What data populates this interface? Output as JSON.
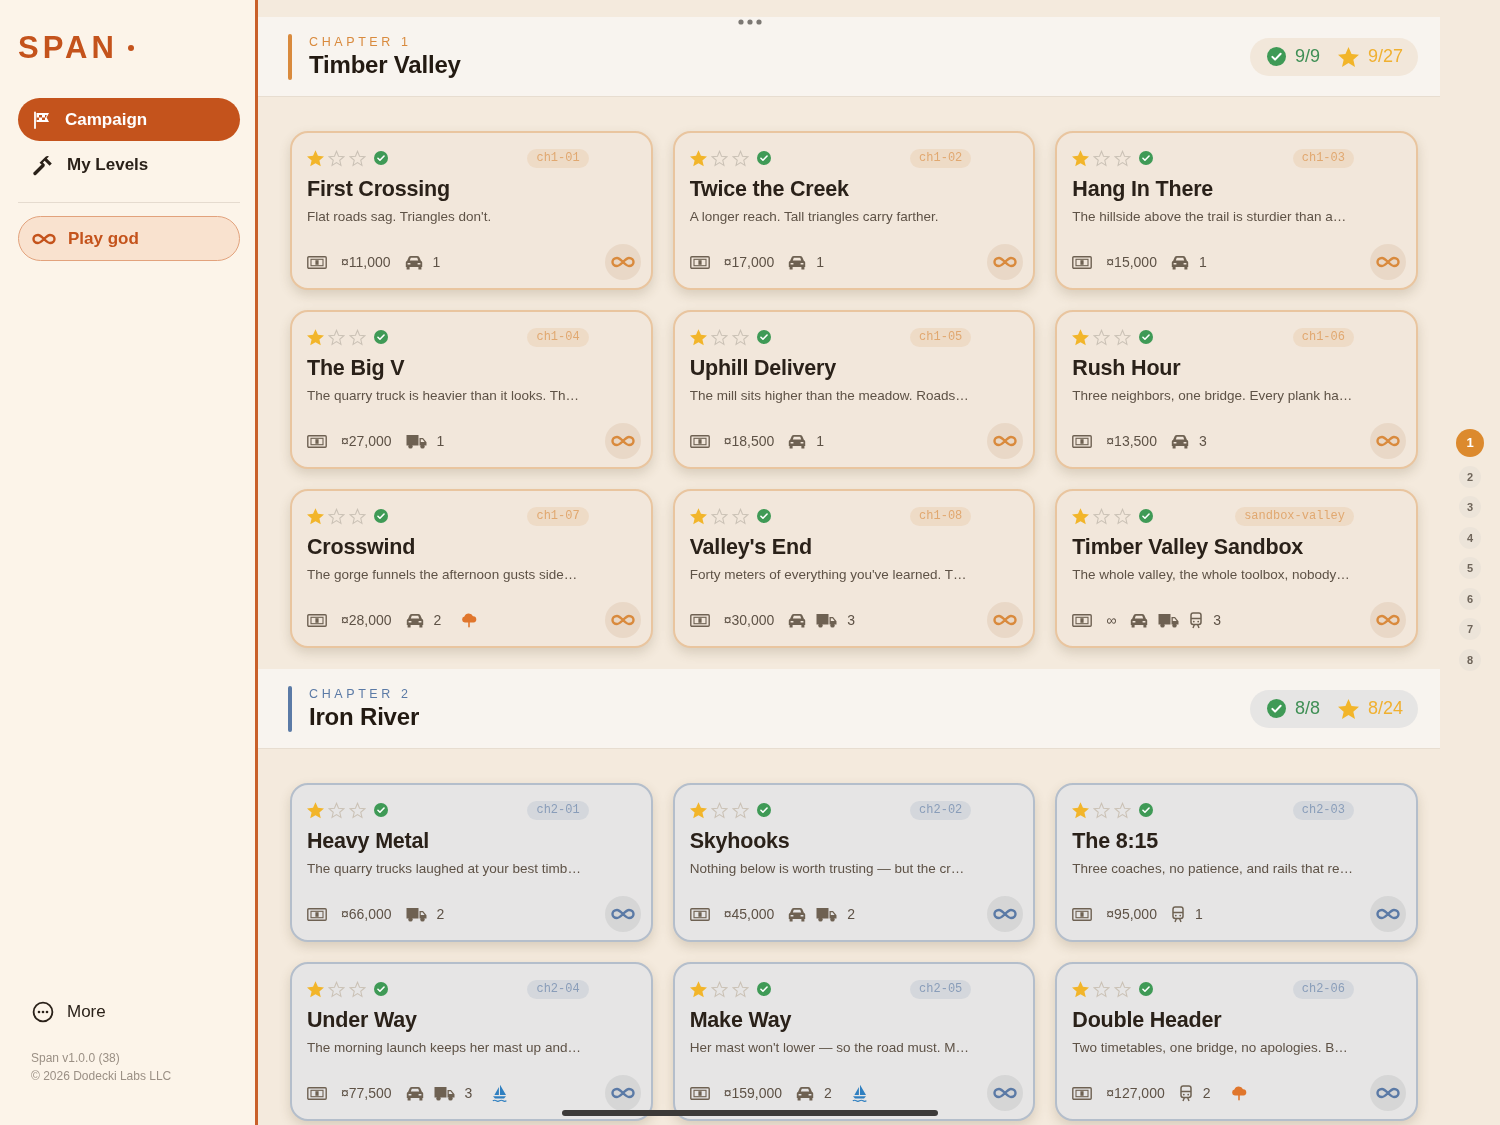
{
  "sidebar": {
    "logo": "SPAN",
    "nav": [
      {
        "label": "Campaign",
        "kind": "flag",
        "selected": true
      },
      {
        "label": "My Levels",
        "kind": "hammer",
        "selected": false
      }
    ],
    "play_button": {
      "label": "Play god"
    },
    "more": {
      "label": "More"
    },
    "version": "Span v1.0.0 (38)",
    "copyright": "© 2026 Dodecki Labs LLC"
  },
  "chapters": [
    {
      "label": "CHAPTER 1",
      "title": "Timber Valley",
      "color": "#d98a3d",
      "completed_count": "9/9",
      "star_count": "9/27",
      "levels": [
        {
          "id": "ch1-01",
          "stars": 1,
          "completed": true,
          "title": "First Crossing",
          "description": "Flat roads sag. Triangles don't.",
          "budget": "¤11,000",
          "vehicles": [
            {
              "kind": "car"
            }
          ],
          "vehicle_count": "1"
        },
        {
          "id": "ch1-02",
          "stars": 1,
          "completed": true,
          "title": "Twice the Creek",
          "description": "A longer reach. Tall triangles carry farther.",
          "budget": "¤17,000",
          "vehicles": [
            {
              "kind": "car"
            }
          ],
          "vehicle_count": "1"
        },
        {
          "id": "ch1-03",
          "stars": 1,
          "completed": true,
          "title": "Hang In There",
          "description": "The hillside above the trail is sturdier than a…",
          "budget": "¤15,000",
          "vehicles": [
            {
              "kind": "car"
            }
          ],
          "vehicle_count": "1"
        },
        {
          "id": "ch1-04",
          "stars": 1,
          "completed": true,
          "title": "The Big V",
          "description": "The quarry truck is heavier than it looks. Th…",
          "budget": "¤27,000",
          "vehicles": [
            {
              "kind": "truck"
            }
          ],
          "vehicle_count": "1"
        },
        {
          "id": "ch1-05",
          "stars": 1,
          "completed": true,
          "title": "Uphill Delivery",
          "description": "The mill sits higher than the meadow. Roads…",
          "budget": "¤18,500",
          "vehicles": [
            {
              "kind": "car"
            }
          ],
          "vehicle_count": "1"
        },
        {
          "id": "ch1-06",
          "stars": 1,
          "completed": true,
          "title": "Rush Hour",
          "description": "Three neighbors, one bridge. Every plank ha…",
          "budget": "¤13,500",
          "vehicles": [
            {
              "kind": "car"
            }
          ],
          "vehicle_count": "3"
        },
        {
          "id": "ch1-07",
          "stars": 1,
          "completed": true,
          "title": "Crosswind",
          "description": "The gorge funnels the afternoon gusts side…",
          "budget": "¤28,000",
          "vehicles": [
            {
              "kind": "car"
            }
          ],
          "vehicle_count": "2",
          "hazards": [
            {
              "kind": "wind"
            }
          ]
        },
        {
          "id": "ch1-08",
          "stars": 1,
          "completed": true,
          "title": "Valley's End",
          "description": "Forty meters of everything you've learned. T…",
          "budget": "¤30,000",
          "vehicles": [
            {
              "kind": "car"
            },
            {
              "kind": "truck"
            }
          ],
          "vehicle_count": "3"
        },
        {
          "id": "sandbox-valley",
          "stars": 1,
          "completed": true,
          "title": "Timber Valley Sandbox",
          "description": "The whole valley, the whole toolbox, nobody…",
          "budget": "∞",
          "vehicles": [
            {
              "kind": "car"
            },
            {
              "kind": "truck"
            },
            {
              "kind": "train"
            }
          ],
          "vehicle_count": "3"
        }
      ]
    },
    {
      "label": "CHAPTER 2",
      "title": "Iron River",
      "color": "#5b7aa6",
      "completed_count": "8/8",
      "star_count": "8/24",
      "levels": [
        {
          "id": "ch2-01",
          "stars": 1,
          "completed": true,
          "title": "Heavy Metal",
          "description": "The quarry trucks laughed at your best timb…",
          "budget": "¤66,000",
          "vehicles": [
            {
              "kind": "truck"
            }
          ],
          "vehicle_count": "2"
        },
        {
          "id": "ch2-02",
          "stars": 1,
          "completed": true,
          "title": "Skyhooks",
          "description": "Nothing below is worth trusting — but the cr…",
          "budget": "¤45,000",
          "vehicles": [
            {
              "kind": "car"
            },
            {
              "kind": "truck"
            }
          ],
          "vehicle_count": "2"
        },
        {
          "id": "ch2-03",
          "stars": 1,
          "completed": true,
          "title": "The 8:15",
          "description": "Three coaches, no patience, and rails that re…",
          "budget": "¤95,000",
          "vehicles": [
            {
              "kind": "train"
            }
          ],
          "vehicle_count": "1"
        },
        {
          "id": "ch2-04",
          "stars": 1,
          "completed": true,
          "title": "Under Way",
          "description": "The morning launch keeps her mast up and…",
          "budget": "¤77,500",
          "vehicles": [
            {
              "kind": "car"
            },
            {
              "kind": "truck"
            }
          ],
          "vehicle_count": "3",
          "hazards": [
            {
              "kind": "boat"
            }
          ]
        },
        {
          "id": "ch2-05",
          "stars": 1,
          "completed": true,
          "title": "Make Way",
          "description": "Her mast won't lower — so the road must. M…",
          "budget": "¤159,000",
          "vehicles": [
            {
              "kind": "car"
            }
          ],
          "vehicle_count": "2",
          "hazards": [
            {
              "kind": "boat"
            }
          ]
        },
        {
          "id": "ch2-06",
          "stars": 1,
          "completed": true,
          "title": "Double Header",
          "description": "Two timetables, one bridge, no apologies. B…",
          "budget": "¤127,000",
          "vehicles": [
            {
              "kind": "train"
            }
          ],
          "vehicle_count": "2",
          "hazards": [
            {
              "kind": "wind"
            }
          ]
        }
      ]
    }
  ],
  "pager": [
    {
      "label": "1",
      "selected": true
    },
    {
      "label": "2",
      "selected": false
    },
    {
      "label": "3",
      "selected": false
    },
    {
      "label": "4",
      "selected": false
    },
    {
      "label": "5",
      "selected": false
    },
    {
      "label": "6",
      "selected": false
    },
    {
      "label": "7",
      "selected": false
    },
    {
      "label": "8",
      "selected": false
    }
  ]
}
